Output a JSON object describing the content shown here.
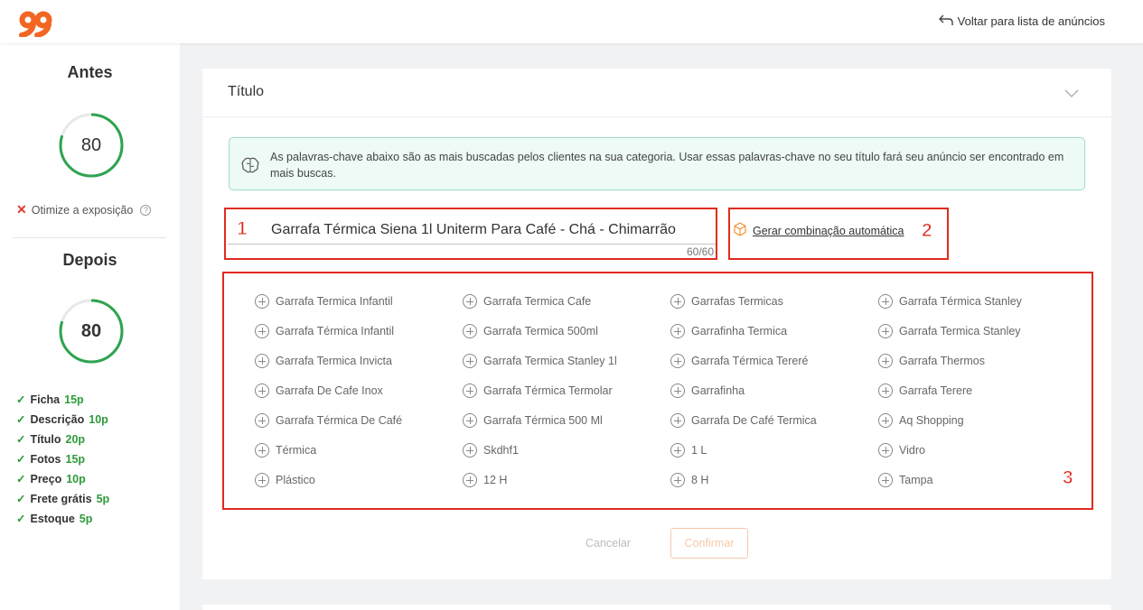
{
  "header": {
    "logo_icon": "99-logo",
    "back_link": "Voltar para lista de anúncios",
    "back_icon": "arrow-back-icon"
  },
  "sidebar": {
    "before": {
      "heading": "Antes",
      "score": "80"
    },
    "optimize_text": "Otimize a exposição",
    "optimize_help": "?",
    "after": {
      "heading": "Depois",
      "score": "80"
    },
    "checklist": [
      {
        "label": "Ficha",
        "points": "15p"
      },
      {
        "label": "Descrição",
        "points": "10p"
      },
      {
        "label": "Título",
        "points": "20p"
      },
      {
        "label": "Fotos",
        "points": "15p"
      },
      {
        "label": "Preço",
        "points": "10p"
      },
      {
        "label": "Frete grátis",
        "points": "5p"
      },
      {
        "label": "Estoque",
        "points": "5p"
      }
    ]
  },
  "card": {
    "title": "Título",
    "info_text": "As palavras-chave abaixo são as mais buscadas pelos clientes na sua categoria. Usar essas palavras-chave no seu título fará seu anúncio ser encontrado em mais buscas.",
    "title_value": "Garrafa Térmica Siena 1l Uniterm Para Café - Chá - Chimarrão",
    "char_count": "60/60",
    "auto_link": "Gerar combinação automática",
    "markers": {
      "m1": "1",
      "m2": "2",
      "m3": "3"
    },
    "keywords": [
      "Garrafa Termica Infantil",
      "Garrafa Termica Cafe",
      "Garrafas Termicas",
      "Garrafa Térmica Stanley",
      "Garrafa Térmica Infantil",
      "Garrafa Termica 500ml",
      "Garrafinha Termica",
      "Garrafa Termica Stanley",
      "Garrafa Termica Invicta",
      "Garrafa Termica Stanley 1l",
      "Garrafa Térmica Tereré",
      "Garrafa Thermos",
      "Garrafa De Cafe Inox",
      "Garrafa Térmica Termolar",
      "Garrafinha",
      "Garrafa Terere",
      "Garrafa Térmica De Café",
      "Garrafa Térmica 500 Ml",
      "Garrafa De Café Termica",
      "Aq Shopping",
      "Térmica",
      "Skdhf1",
      "1 L",
      "Vidro",
      "Plástico",
      "12 H",
      "8 H",
      "Tampa"
    ],
    "cancel_label": "Cancelar",
    "confirm_label": "Confirmar"
  },
  "colors": {
    "score_ring": "#2ea44f",
    "marker_red": "#e02b20",
    "info_bg": "#edfaf6",
    "confirm": "#f7c8aa"
  }
}
